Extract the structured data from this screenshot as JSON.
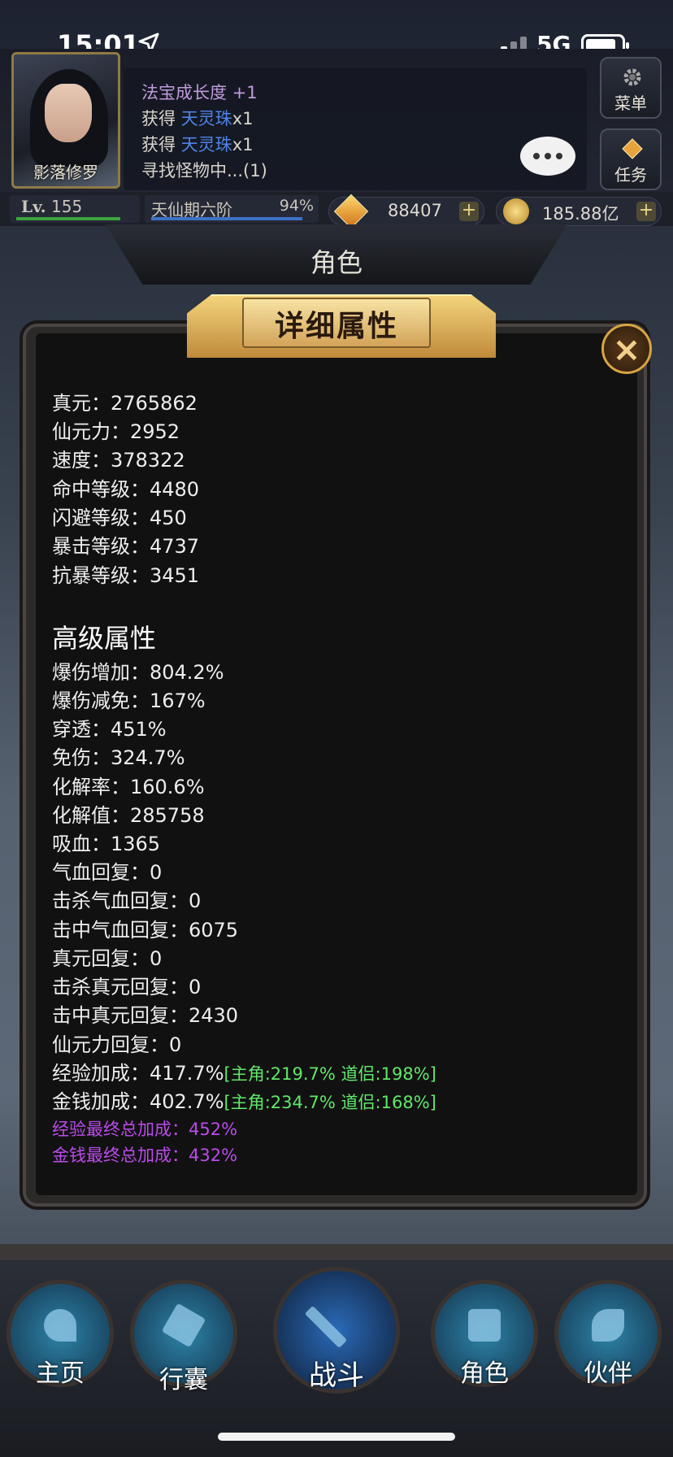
{
  "status_bar": {
    "time": "15:01",
    "network": "5G"
  },
  "player": {
    "name": "影落修罗",
    "level_label": "Lv.",
    "level": "155",
    "realm": "天仙期六阶",
    "realm_progress": "94%",
    "realm_progress_value": 0.94
  },
  "log": {
    "line1_text": "法宝成长度",
    "line1_value": "+1",
    "line2_prefix": "获得",
    "line2_item": "天灵珠",
    "line2_count": "x1",
    "line3_prefix": "获得",
    "line3_item": "天灵珠",
    "line3_count": "x1",
    "line4": "寻找怪物中...(1)"
  },
  "side_buttons": {
    "menu": "菜单",
    "quest": "任务"
  },
  "currency": {
    "gems": "88407",
    "gold": "185.88亿",
    "plus": "+"
  },
  "page_title": "角色",
  "panel": {
    "title": "详细属性",
    "close_icon": "close-icon",
    "basic": [
      "真元：2765862",
      "仙元力：2952",
      "速度：378322",
      "命中等级：4480",
      "闪避等级：450",
      "暴击等级：4737",
      "抗暴等级：3451"
    ],
    "advanced_title": "高级属性",
    "advanced": [
      "爆伤增加：804.2%",
      "爆伤减免：167%",
      "穿透：451%",
      "免伤：324.7%",
      "化解率：160.6%",
      "化解值：285758",
      "吸血：1365",
      "气血回复：0",
      "击杀气血回复：0",
      "击中气血回复：6075",
      "真元回复：0",
      "击杀真元回复：0",
      "击中真元回复：2430",
      "仙元力回复：0"
    ],
    "exp_bonus": "经验加成：417.7%",
    "exp_bonus_detail": "[主角:219.7% 道侣:198%]",
    "gold_bonus": "金钱加成：402.7%",
    "gold_bonus_detail": "[主角:234.7% 道侣:168%]",
    "exp_final": "经验最终总加成：452%",
    "gold_final": "金钱最终总加成：432%"
  },
  "nav": {
    "home": "主页",
    "bag": "行囊",
    "battle": "战斗",
    "role": "角色",
    "partner": "伙伴"
  },
  "colors": {
    "advanced_bonus_green": "#5fe86a",
    "final_bonus_purple": "#b94bea",
    "gold_accent": "#d8a543"
  }
}
